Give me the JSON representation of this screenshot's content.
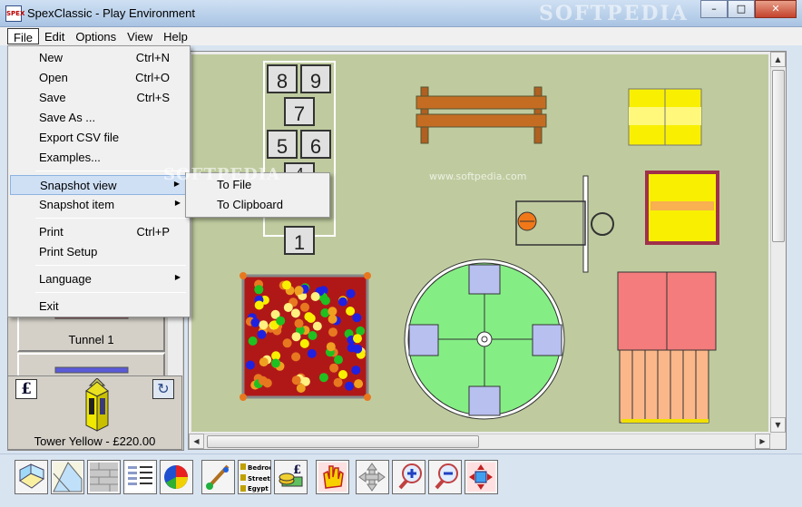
{
  "window": {
    "app_icon_text": "SPEX",
    "title": "SpexClassic - Play Environment",
    "watermark": "SOFTPEDIA",
    "minimize": "–",
    "maximize": "□",
    "close": "✕"
  },
  "menubar": [
    "File",
    "Edit",
    "Options",
    "View",
    "Help"
  ],
  "file_menu": {
    "items": [
      {
        "label": "New",
        "shortcut": "Ctrl+N"
      },
      {
        "label": "Open",
        "shortcut": "Ctrl+O"
      },
      {
        "label": "Save",
        "shortcut": "Ctrl+S"
      },
      {
        "label": "Save As ...",
        "shortcut": ""
      },
      {
        "label": "Export CSV file",
        "shortcut": ""
      },
      {
        "label": "Examples...",
        "shortcut": ""
      },
      {
        "label": "Snapshot view",
        "submenu": true,
        "highlighted": true
      },
      {
        "label": "Snapshot item",
        "submenu": true
      },
      {
        "label": "Print",
        "shortcut": "Ctrl+P"
      },
      {
        "label": "Print Setup",
        "shortcut": ""
      },
      {
        "label": "Language",
        "submenu": true
      },
      {
        "label": "Exit",
        "shortcut": ""
      }
    ]
  },
  "snapshot_submenu": [
    "To File",
    "To Clipboard"
  ],
  "palette": {
    "tunnel_label": "Tunnel 1",
    "preview_label": "Tower Yellow - £220.00",
    "currency_icon": "£",
    "rotate_icon": "↻"
  },
  "canvas": {
    "hopscotch_numbers": [
      "8",
      "9",
      "7",
      "5",
      "6",
      "4",
      "1"
    ],
    "watermark": "SOFTPEDIA",
    "watermark_url": "www.softpedia.com"
  },
  "toolbar": {
    "street_label": "Bedroo",
    "street_label2": "Street",
    "street_label3": "Egypt",
    "pound": "£"
  },
  "colors": {
    "grass": "#bfcb9f",
    "ballpit": "#b01818",
    "roundabout": "#84ee84",
    "tower": "#f8f000",
    "slide_pink": "#f47c7c",
    "slide_orange": "#fbb78a"
  }
}
